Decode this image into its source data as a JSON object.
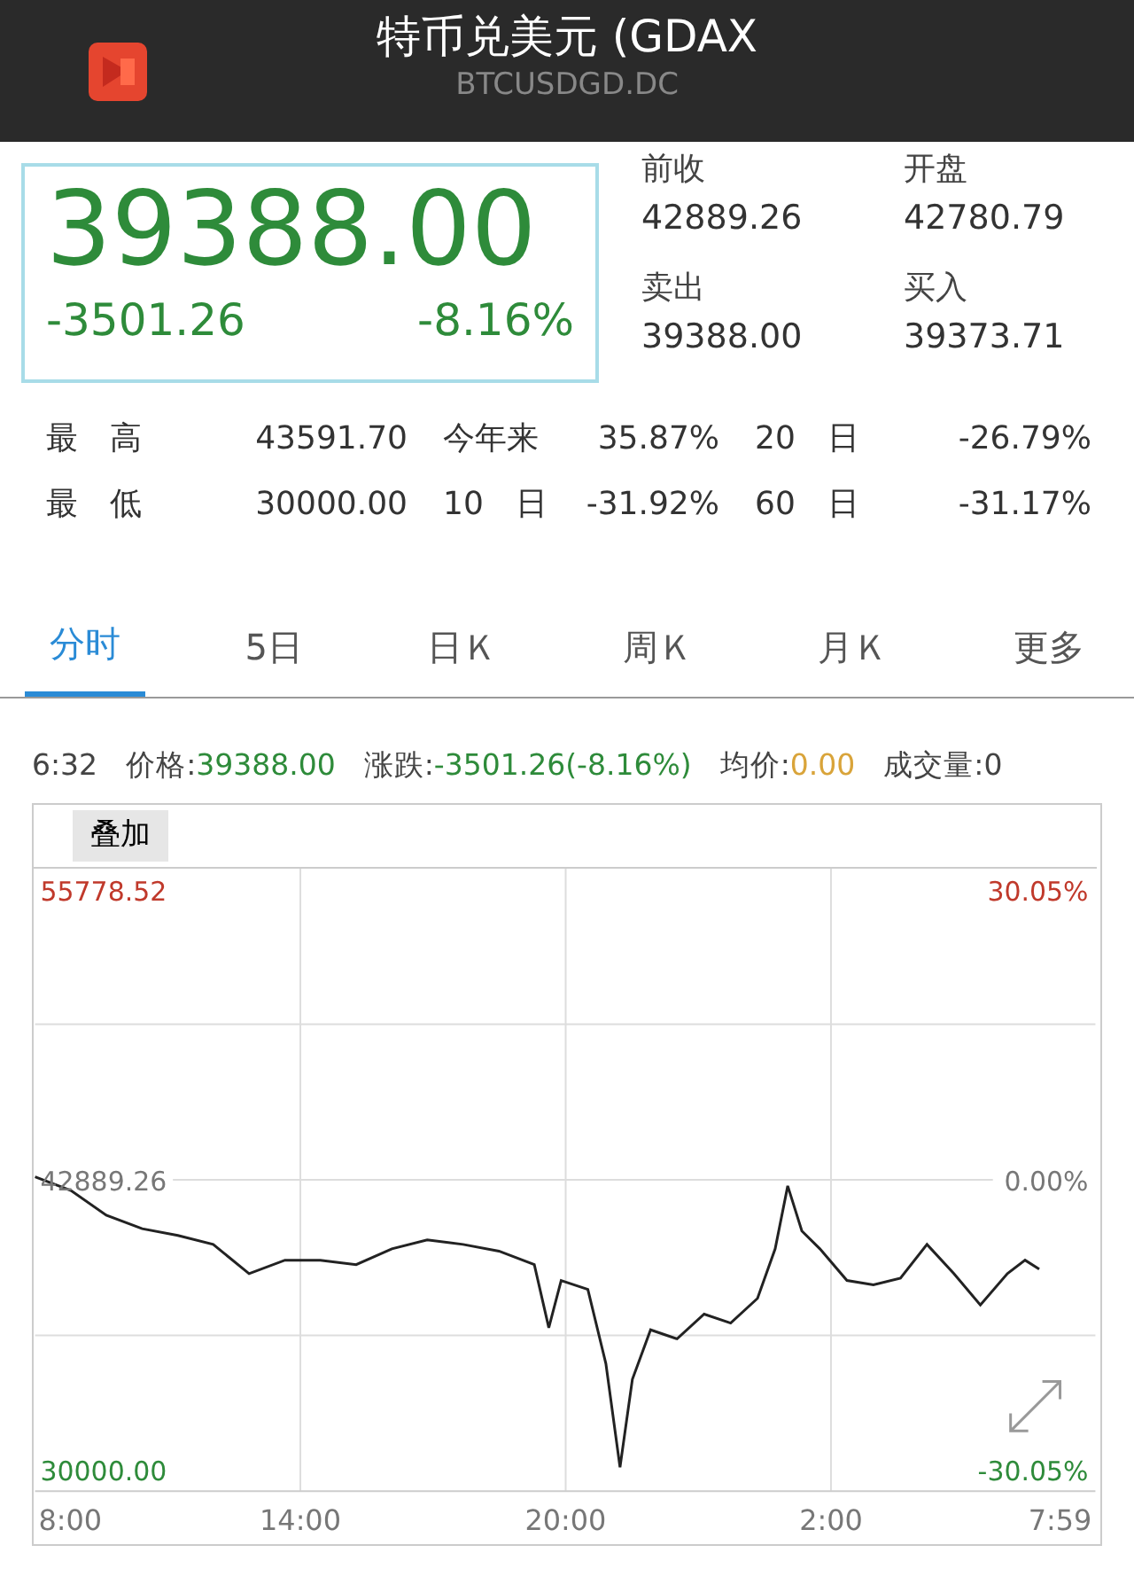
{
  "header": {
    "title": "特币兑美元 (GDAX",
    "subtitle": "BTCUSDGD.DC"
  },
  "quote": {
    "price": "39388.00",
    "change": "-3501.26",
    "change_pct": "-8.16%"
  },
  "quote_fields": [
    {
      "label": "前收",
      "value": "42889.26"
    },
    {
      "label": "开盘",
      "value": "42780.79"
    },
    {
      "label": "卖出",
      "value": "39388.00"
    },
    {
      "label": "买入",
      "value": "39373.71"
    }
  ],
  "stats": [
    {
      "label": "最　高",
      "value": "43591.70"
    },
    {
      "label": "今年来",
      "value": "35.87%"
    },
    {
      "label": "20　日",
      "value": "-26.79%"
    },
    {
      "label": "最　低",
      "value": "30000.00"
    },
    {
      "label": "10　日",
      "value": "-31.92%"
    },
    {
      "label": "60　日",
      "value": "-31.17%"
    }
  ],
  "tabs": [
    {
      "label": "分时",
      "selected": true
    },
    {
      "label": "5日",
      "selected": false
    },
    {
      "label": "日Ｋ",
      "selected": false
    },
    {
      "label": "周Ｋ",
      "selected": false
    },
    {
      "label": "月Ｋ",
      "selected": false
    },
    {
      "label": "更多",
      "selected": false
    }
  ],
  "info_bar": {
    "time": "6:32",
    "price_label": "价格:",
    "price": "39388.00",
    "change_label": "涨跌:",
    "change": "-3501.26(-8.16%)",
    "avg_label": "均价:",
    "avg": "0.00",
    "volume_label": "成交量:",
    "volume": "0"
  },
  "overlay_button": "叠加",
  "chart": {
    "right_ticks": [
      "30.05%",
      "0.00%",
      "-30.05%"
    ],
    "next_day_ticks": [
      "2:00",
      "7:59"
    ],
    "chart_data": {
      "type": "line",
      "x": [
        8,
        8.81,
        9.61,
        10.42,
        11.23,
        12.03,
        12.84,
        13.65,
        14.45,
        15.26,
        16.07,
        16.87,
        17.68,
        18.49,
        19.29,
        19.62,
        19.9,
        20.5,
        20.91,
        21.23,
        21.51,
        21.92,
        22.52,
        23.13,
        23.73,
        24.34,
        24.74,
        25.02,
        25.34,
        25.75,
        26.36,
        26.96,
        27.57,
        28.17,
        28.78,
        29.38,
        29.99,
        30.39,
        30.71
      ],
      "xticks": [
        {
          "value": 8,
          "label": "8:00"
        },
        {
          "value": 14,
          "label": "14:00"
        },
        {
          "value": 20,
          "label": "20:00"
        }
      ],
      "series": [
        {
          "color": "#222222",
          "values": [
            43100,
            42500,
            41400,
            40800,
            40500,
            40100,
            38800,
            39400,
            39400,
            39200,
            39900,
            40300,
            40100,
            39800,
            39200,
            36400,
            38500,
            38100,
            34800,
            30200,
            34100,
            36300,
            35900,
            37000,
            36600,
            37700,
            39900,
            42700,
            40700,
            39900,
            38500,
            38300,
            38600,
            40100,
            38800,
            37400,
            38800,
            39400,
            39000
          ]
        }
      ],
      "xlim": [
        8,
        31.98
      ],
      "ylim": [
        29136,
        56800
      ],
      "grid": true,
      "yticks": [
        {
          "value": 30000,
          "label": "30000.00"
        },
        {
          "value": 42889.26,
          "label": "42889.26"
        },
        {
          "value": 55778.52,
          "label": "55778.52"
        }
      ]
    }
  }
}
